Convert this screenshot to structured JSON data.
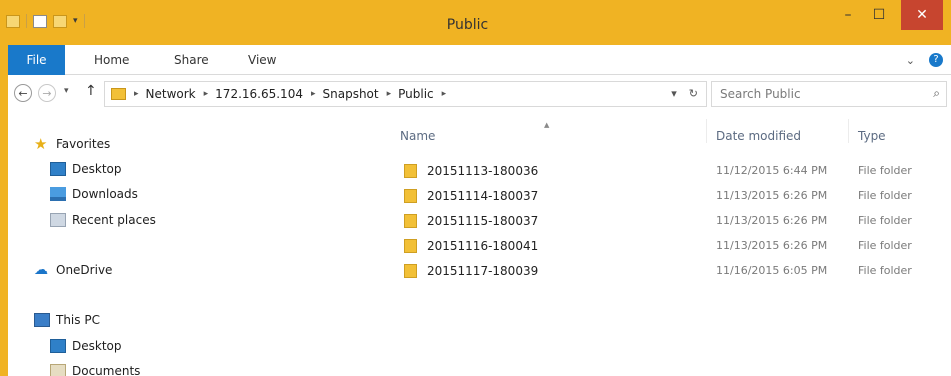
{
  "window": {
    "title": "Public",
    "controls": {
      "minimize": "–",
      "maximize": "☐",
      "close": "✕"
    }
  },
  "ribbon": {
    "tabs": [
      {
        "label": "File"
      },
      {
        "label": "Home"
      },
      {
        "label": "Share"
      },
      {
        "label": "View"
      }
    ]
  },
  "address": {
    "breadcrumbs": [
      "Network",
      "172.16.65.104",
      "Snapshot",
      "Public"
    ],
    "search_placeholder": "Search Public"
  },
  "navigation": {
    "favorites_label": "Favorites",
    "favorites": [
      "Desktop",
      "Downloads",
      "Recent places"
    ],
    "onedrive_label": "OneDrive",
    "thispc_label": "This PC",
    "thispc_items": [
      "Desktop",
      "Documents"
    ]
  },
  "files": {
    "columns": {
      "name": "Name",
      "date": "Date modified",
      "type": "Type"
    },
    "rows": [
      {
        "name": "20151113-180036",
        "date": "11/12/2015 6:44 PM",
        "type": "File folder"
      },
      {
        "name": "20151114-180037",
        "date": "11/13/2015 6:26 PM",
        "type": "File folder"
      },
      {
        "name": "20151115-180037",
        "date": "11/13/2015 6:26 PM",
        "type": "File folder"
      },
      {
        "name": "20151116-180041",
        "date": "11/13/2015 6:26 PM",
        "type": "File folder"
      },
      {
        "name": "20151117-180039",
        "date": "11/16/2015 6:05 PM",
        "type": "File folder"
      }
    ]
  },
  "colors": {
    "accent": "#1979ca",
    "frame": "#f0b323",
    "close": "#c7452f"
  }
}
